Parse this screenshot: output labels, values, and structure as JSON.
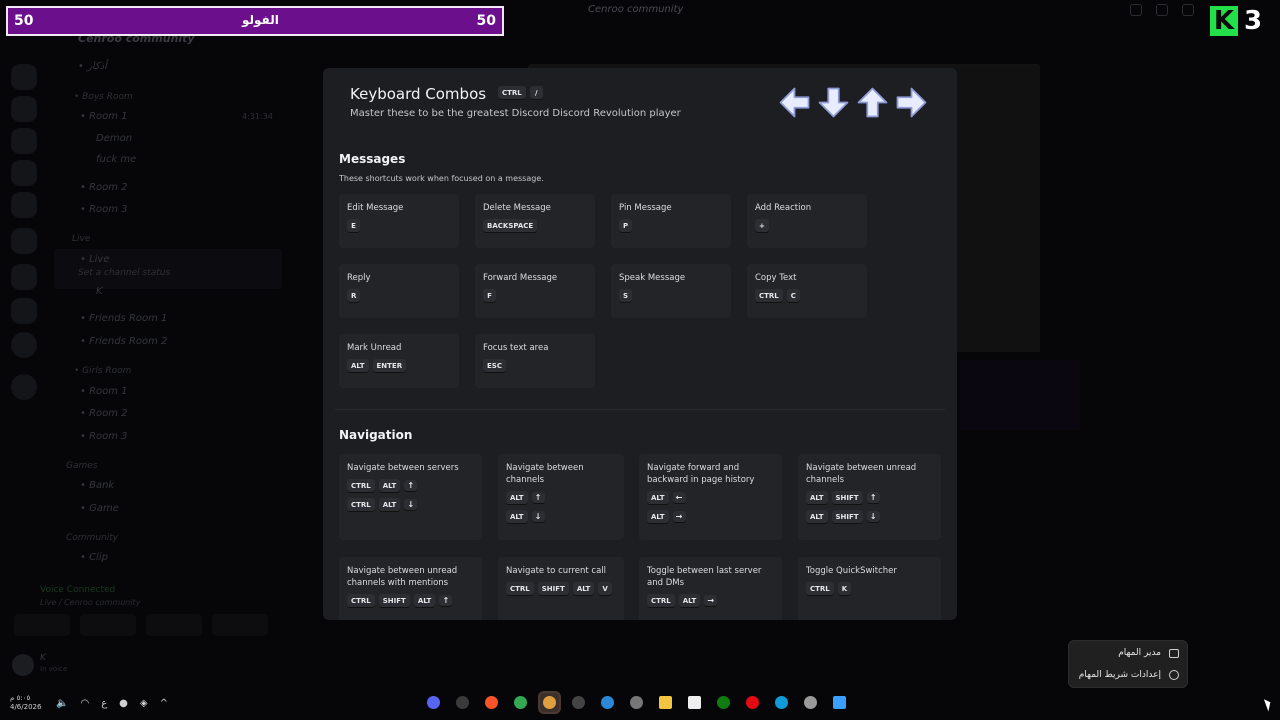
{
  "window": {
    "title": "Cenroo community"
  },
  "sidebar": {
    "server_name": "Cenroo community",
    "channels": [
      {
        "name": "• أذكار",
        "type": "text"
      },
      {
        "name": "• Boys Room",
        "type": "category"
      },
      {
        "name": "• Room 1",
        "type": "voice"
      },
      {
        "name": "Demon",
        "type": "member"
      },
      {
        "name": "fuck me",
        "type": "member"
      },
      {
        "name": "• Room 2",
        "type": "voice"
      },
      {
        "name": "• Room 3",
        "type": "voice"
      },
      {
        "name": "Live",
        "type": "category"
      },
      {
        "name": "• Live",
        "type": "voice"
      },
      {
        "name": "Set a channel status",
        "type": "status"
      },
      {
        "name": "K",
        "type": "member"
      },
      {
        "name": "• Friends Room 1",
        "type": "voice"
      },
      {
        "name": "• Friends Room 2",
        "type": "voice"
      },
      {
        "name": "• Girls Room",
        "type": "category"
      },
      {
        "name": "• Room 1",
        "type": "voice"
      },
      {
        "name": "• Room 2",
        "type": "voice"
      },
      {
        "name": "• Room 3",
        "type": "voice"
      },
      {
        "name": "Games",
        "type": "category"
      },
      {
        "name": "• Bank",
        "type": "text"
      },
      {
        "name": "• Game",
        "type": "text"
      },
      {
        "name": "Community",
        "type": "category"
      },
      {
        "name": "• Clip",
        "type": "text"
      }
    ],
    "call_time": "4:31:34",
    "voice": {
      "status": "Voice Connected",
      "location": "Live / Cenroo community"
    },
    "user": {
      "name": "K",
      "status": "In voice"
    }
  },
  "overlay": {
    "score_left": "50",
    "score_right": "50",
    "score_label": "الفولو",
    "corner_letter": "K",
    "corner_number": "3"
  },
  "modal": {
    "title": "Keyboard Combos",
    "title_keys": [
      "CTRL",
      "/"
    ],
    "subtitle": "Master these to be the greatest Discord Discord Revolution player",
    "messages": {
      "heading": "Messages",
      "description": "These shortcuts work when focused on a message.",
      "items": [
        {
          "label": "Edit Message",
          "keys": [
            "E"
          ]
        },
        {
          "label": "Delete Message",
          "keys": [
            "BACKSPACE"
          ]
        },
        {
          "label": "Pin Message",
          "keys": [
            "P"
          ]
        },
        {
          "label": "Add Reaction",
          "keys": [
            "+"
          ]
        },
        {
          "label": "Reply",
          "keys": [
            "R"
          ]
        },
        {
          "label": "Forward Message",
          "keys": [
            "F"
          ]
        },
        {
          "label": "Speak Message",
          "keys": [
            "S"
          ]
        },
        {
          "label": "Copy Text",
          "keys": [
            "CTRL",
            "C"
          ]
        },
        {
          "label": "Mark Unread",
          "keys": [
            "ALT",
            "ENTER"
          ]
        },
        {
          "label": "Focus text area",
          "keys": [
            "ESC"
          ]
        }
      ]
    },
    "navigation": {
      "heading": "Navigation",
      "items": [
        {
          "label": "Navigate between servers",
          "rows": [
            [
              "CTRL",
              "ALT",
              "↑"
            ],
            [
              "CTRL",
              "ALT",
              "↓"
            ]
          ]
        },
        {
          "label": "Navigate between channels",
          "rows": [
            [
              "ALT",
              "↑"
            ],
            [
              "ALT",
              "↓"
            ]
          ]
        },
        {
          "label": "Navigate forward and backward in page history",
          "rows": [
            [
              "ALT",
              "←"
            ],
            [
              "ALT",
              "→"
            ]
          ]
        },
        {
          "label": "Navigate between unread channels",
          "rows": [
            [
              "ALT",
              "SHIFT",
              "↑"
            ],
            [
              "ALT",
              "SHIFT",
              "↓"
            ]
          ]
        },
        {
          "label": "Navigate between unread channels with mentions",
          "rows": [
            [
              "CTRL",
              "SHIFT",
              "ALT",
              "↑"
            ]
          ]
        },
        {
          "label": "Navigate to current call",
          "rows": [
            [
              "CTRL",
              "SHIFT",
              "ALT",
              "V"
            ]
          ]
        },
        {
          "label": "Toggle between last server and DMs",
          "rows": [
            [
              "CTRL",
              "ALT",
              "→"
            ]
          ]
        },
        {
          "label": "Toggle QuickSwitcher",
          "rows": [
            [
              "CTRL",
              "K"
            ]
          ]
        }
      ]
    }
  },
  "context_menu": {
    "items": [
      {
        "label": "مدير المهام",
        "icon": "task-manager-icon"
      },
      {
        "label": "إعدادات شريط المهام",
        "icon": "gear-icon"
      }
    ]
  },
  "taskbar": {
    "clock_time": "٥:٠٥ م",
    "clock_date": "4/6/2026",
    "lang": "ع",
    "apps": [
      {
        "name": "discord-icon",
        "color": "#5865f2"
      },
      {
        "name": "obs-icon",
        "color": "#3a3a3a"
      },
      {
        "name": "brave-icon",
        "color": "#fb542b"
      },
      {
        "name": "chrome-icon",
        "color": "#34a853"
      },
      {
        "name": "game-icon",
        "color": "#e0a040"
      },
      {
        "name": "phone-icon",
        "color": "#444444"
      },
      {
        "name": "photos-icon",
        "color": "#2b88d8"
      },
      {
        "name": "app-icon",
        "color": "#777777"
      },
      {
        "name": "files-icon",
        "color": "#f4c542"
      },
      {
        "name": "store-icon",
        "color": "#eeeeee"
      },
      {
        "name": "xbox-icon",
        "color": "#107c10"
      },
      {
        "name": "netflix-icon",
        "color": "#e50914"
      },
      {
        "name": "edge-icon",
        "color": "#0f9bd7"
      },
      {
        "name": "settings-icon",
        "color": "#9a9a9a"
      },
      {
        "name": "windows-icon",
        "color": "#3aa0ff"
      }
    ]
  }
}
